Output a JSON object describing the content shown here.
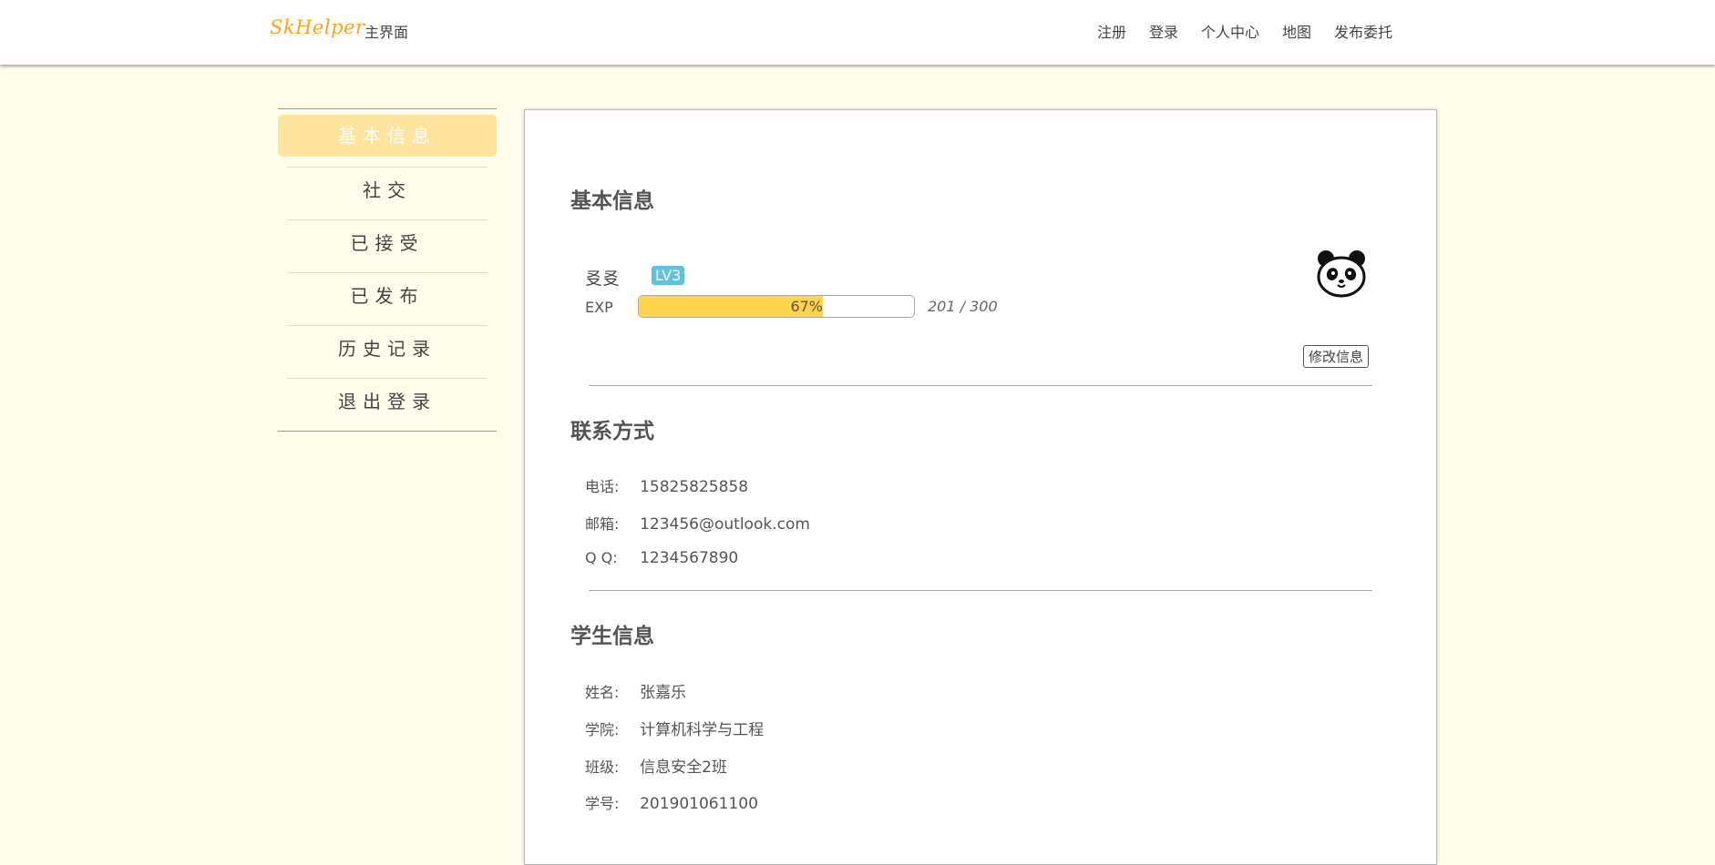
{
  "header": {
    "logo": "SkHelper",
    "home": "主界面",
    "nav": [
      "注册",
      "登录",
      "个人中心",
      "地图",
      "发布委托"
    ]
  },
  "sidebar": {
    "items": [
      "基本信息",
      "社交",
      "已接受",
      "已发布",
      "历史记录",
      "退出登录"
    ],
    "active_index": 0
  },
  "basic": {
    "title": "基本信息",
    "username": "㕛㕛",
    "level": "LV3",
    "exp_label": "EXP",
    "exp_percent_text": "67%",
    "exp_fraction": 0.67,
    "exp_value": "201 / 300",
    "avatar_icon": "panda-avatar",
    "edit_button": "修改信息"
  },
  "contact": {
    "title": "联系方式",
    "rows": [
      {
        "label": "电话:",
        "value": "15825825858"
      },
      {
        "label": "邮箱:",
        "value": "123456@outlook.com"
      },
      {
        "label": "Q Q:",
        "value": "1234567890"
      }
    ]
  },
  "student": {
    "title": "学生信息",
    "rows": [
      {
        "label": "姓名:",
        "value": "张嘉乐"
      },
      {
        "label": "学院:",
        "value": "计算机科学与工程"
      },
      {
        "label": "班级:",
        "value": "信息安全2班"
      },
      {
        "label": "学号:",
        "value": "201901061100"
      }
    ]
  },
  "colors": {
    "page_bg": "#fffdeb",
    "accent": "#ffa31a",
    "active_tab": "#ffe4a0",
    "exp_fill": "#ffd34d",
    "level_badge": "#62c2dc"
  }
}
